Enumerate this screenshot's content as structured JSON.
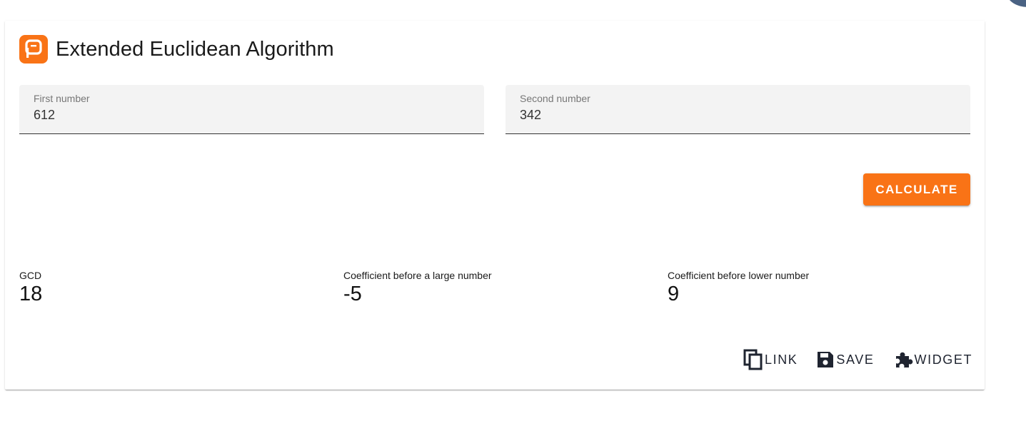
{
  "header": {
    "title": "Extended Euclidean Algorithm",
    "logo_icon": "planetcalc-logo-icon",
    "accent_color": "#f97316"
  },
  "inputs": {
    "first": {
      "label": "First number",
      "value": "612"
    },
    "second": {
      "label": "Second number",
      "value": "342"
    }
  },
  "calculate_label": "CALCULATE",
  "results": {
    "gcd": {
      "label": "GCD",
      "value": "18"
    },
    "coef_large": {
      "label": "Coefficient before a large number",
      "value": "-5"
    },
    "coef_lower": {
      "label": "Coefficient before lower number",
      "value": "9"
    }
  },
  "actions": {
    "link": {
      "label": "LINK",
      "icon": "copy-icon"
    },
    "save": {
      "label": "SAVE",
      "icon": "floppy-disk-icon"
    },
    "widget": {
      "label": "WIDGET",
      "icon": "puzzle-piece-icon"
    }
  }
}
